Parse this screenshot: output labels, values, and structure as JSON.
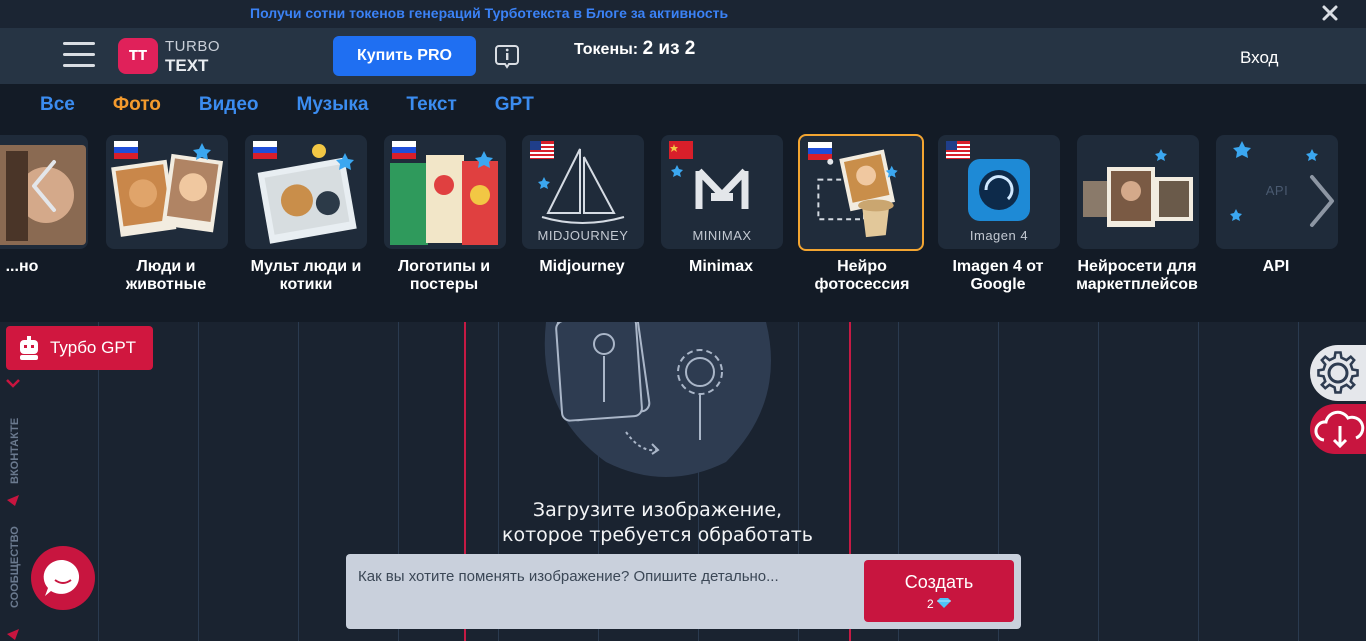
{
  "promo": {
    "text": "Получи сотни токенов генераций Турботекста в Блоге за активность"
  },
  "header": {
    "logo_mark": "TT",
    "logo_turbo": "TURBO",
    "logo_text": "TEXT",
    "buy_pro": "Купить PRO",
    "tokens_label": "Токены:",
    "tokens_value": "2 из 2",
    "login": "Вход"
  },
  "tabs": [
    {
      "label": "Все",
      "active": false
    },
    {
      "label": "Фото",
      "active": true
    },
    {
      "label": "Видео",
      "active": false
    },
    {
      "label": "Музыка",
      "active": false
    },
    {
      "label": "Текст",
      "active": false
    },
    {
      "label": "GPT",
      "active": false
    }
  ],
  "cards": [
    {
      "label": "...но",
      "flag": "",
      "caption": ""
    },
    {
      "label": "Люди и животные",
      "flag": "ru",
      "caption": ""
    },
    {
      "label": "Мульт люди и котики",
      "flag": "ru",
      "caption": ""
    },
    {
      "label": "Логотипы и постеры",
      "flag": "ru",
      "caption": ""
    },
    {
      "label": "Midjourney",
      "flag": "us",
      "caption": "MIDJOURNEY"
    },
    {
      "label": "Minimax",
      "flag": "cn",
      "caption": "MINIMAX"
    },
    {
      "label": "Нейро фотосессия",
      "flag": "ru",
      "caption": "",
      "selected": true
    },
    {
      "label": "Imagen 4 от Google",
      "flag": "us",
      "caption": "Imagen 4"
    },
    {
      "label": "Нейросети для маркетплейсов",
      "flag": "",
      "caption": ""
    },
    {
      "label": "API",
      "flag": "",
      "caption": "API"
    }
  ],
  "sidebar": {
    "turbo_gpt": "Турбо GPT",
    "social_vk": "ВКОНТАКТЕ",
    "social_tg": "СООБЩЕСТВО"
  },
  "upload": {
    "line1": "Загрузите изображение,",
    "line2": "которое требуется обработать"
  },
  "prompt": {
    "placeholder": "Как вы хотите поменять изображение? Опишите детально...",
    "create_label": "Создать",
    "create_cost": "2"
  },
  "icons": [
    "menu-icon",
    "info-icon",
    "close-icon",
    "chevron-left-icon",
    "chevron-right-icon",
    "gear-icon",
    "cloud-download-icon",
    "chat-icon",
    "robot-icon",
    "diamond-icon"
  ],
  "colors": {
    "accent": "#1f6ff2",
    "brand": "#e0215a",
    "active_tab": "#f39a2d",
    "tab": "#3b8cf0"
  }
}
